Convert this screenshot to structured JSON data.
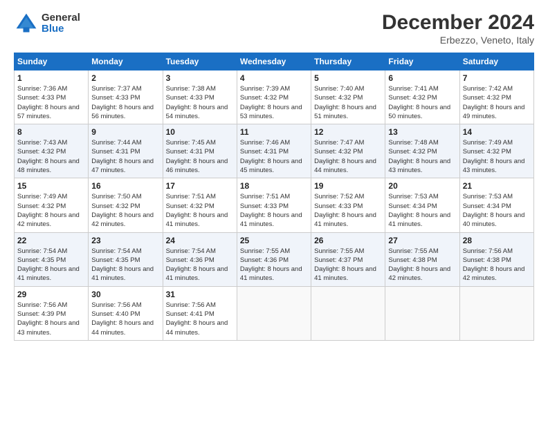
{
  "header": {
    "logo_general": "General",
    "logo_blue": "Blue",
    "title": "December 2024",
    "location": "Erbezzo, Veneto, Italy"
  },
  "weekdays": [
    "Sunday",
    "Monday",
    "Tuesday",
    "Wednesday",
    "Thursday",
    "Friday",
    "Saturday"
  ],
  "weeks": [
    [
      {
        "day": "1",
        "sunrise": "Sunrise: 7:36 AM",
        "sunset": "Sunset: 4:33 PM",
        "daylight": "Daylight: 8 hours and 57 minutes."
      },
      {
        "day": "2",
        "sunrise": "Sunrise: 7:37 AM",
        "sunset": "Sunset: 4:33 PM",
        "daylight": "Daylight: 8 hours and 56 minutes."
      },
      {
        "day": "3",
        "sunrise": "Sunrise: 7:38 AM",
        "sunset": "Sunset: 4:33 PM",
        "daylight": "Daylight: 8 hours and 54 minutes."
      },
      {
        "day": "4",
        "sunrise": "Sunrise: 7:39 AM",
        "sunset": "Sunset: 4:32 PM",
        "daylight": "Daylight: 8 hours and 53 minutes."
      },
      {
        "day": "5",
        "sunrise": "Sunrise: 7:40 AM",
        "sunset": "Sunset: 4:32 PM",
        "daylight": "Daylight: 8 hours and 51 minutes."
      },
      {
        "day": "6",
        "sunrise": "Sunrise: 7:41 AM",
        "sunset": "Sunset: 4:32 PM",
        "daylight": "Daylight: 8 hours and 50 minutes."
      },
      {
        "day": "7",
        "sunrise": "Sunrise: 7:42 AM",
        "sunset": "Sunset: 4:32 PM",
        "daylight": "Daylight: 8 hours and 49 minutes."
      }
    ],
    [
      {
        "day": "8",
        "sunrise": "Sunrise: 7:43 AM",
        "sunset": "Sunset: 4:32 PM",
        "daylight": "Daylight: 8 hours and 48 minutes."
      },
      {
        "day": "9",
        "sunrise": "Sunrise: 7:44 AM",
        "sunset": "Sunset: 4:31 PM",
        "daylight": "Daylight: 8 hours and 47 minutes."
      },
      {
        "day": "10",
        "sunrise": "Sunrise: 7:45 AM",
        "sunset": "Sunset: 4:31 PM",
        "daylight": "Daylight: 8 hours and 46 minutes."
      },
      {
        "day": "11",
        "sunrise": "Sunrise: 7:46 AM",
        "sunset": "Sunset: 4:31 PM",
        "daylight": "Daylight: 8 hours and 45 minutes."
      },
      {
        "day": "12",
        "sunrise": "Sunrise: 7:47 AM",
        "sunset": "Sunset: 4:32 PM",
        "daylight": "Daylight: 8 hours and 44 minutes."
      },
      {
        "day": "13",
        "sunrise": "Sunrise: 7:48 AM",
        "sunset": "Sunset: 4:32 PM",
        "daylight": "Daylight: 8 hours and 43 minutes."
      },
      {
        "day": "14",
        "sunrise": "Sunrise: 7:49 AM",
        "sunset": "Sunset: 4:32 PM",
        "daylight": "Daylight: 8 hours and 43 minutes."
      }
    ],
    [
      {
        "day": "15",
        "sunrise": "Sunrise: 7:49 AM",
        "sunset": "Sunset: 4:32 PM",
        "daylight": "Daylight: 8 hours and 42 minutes."
      },
      {
        "day": "16",
        "sunrise": "Sunrise: 7:50 AM",
        "sunset": "Sunset: 4:32 PM",
        "daylight": "Daylight: 8 hours and 42 minutes."
      },
      {
        "day": "17",
        "sunrise": "Sunrise: 7:51 AM",
        "sunset": "Sunset: 4:32 PM",
        "daylight": "Daylight: 8 hours and 41 minutes."
      },
      {
        "day": "18",
        "sunrise": "Sunrise: 7:51 AM",
        "sunset": "Sunset: 4:33 PM",
        "daylight": "Daylight: 8 hours and 41 minutes."
      },
      {
        "day": "19",
        "sunrise": "Sunrise: 7:52 AM",
        "sunset": "Sunset: 4:33 PM",
        "daylight": "Daylight: 8 hours and 41 minutes."
      },
      {
        "day": "20",
        "sunrise": "Sunrise: 7:53 AM",
        "sunset": "Sunset: 4:34 PM",
        "daylight": "Daylight: 8 hours and 41 minutes."
      },
      {
        "day": "21",
        "sunrise": "Sunrise: 7:53 AM",
        "sunset": "Sunset: 4:34 PM",
        "daylight": "Daylight: 8 hours and 40 minutes."
      }
    ],
    [
      {
        "day": "22",
        "sunrise": "Sunrise: 7:54 AM",
        "sunset": "Sunset: 4:35 PM",
        "daylight": "Daylight: 8 hours and 41 minutes."
      },
      {
        "day": "23",
        "sunrise": "Sunrise: 7:54 AM",
        "sunset": "Sunset: 4:35 PM",
        "daylight": "Daylight: 8 hours and 41 minutes."
      },
      {
        "day": "24",
        "sunrise": "Sunrise: 7:54 AM",
        "sunset": "Sunset: 4:36 PM",
        "daylight": "Daylight: 8 hours and 41 minutes."
      },
      {
        "day": "25",
        "sunrise": "Sunrise: 7:55 AM",
        "sunset": "Sunset: 4:36 PM",
        "daylight": "Daylight: 8 hours and 41 minutes."
      },
      {
        "day": "26",
        "sunrise": "Sunrise: 7:55 AM",
        "sunset": "Sunset: 4:37 PM",
        "daylight": "Daylight: 8 hours and 41 minutes."
      },
      {
        "day": "27",
        "sunrise": "Sunrise: 7:55 AM",
        "sunset": "Sunset: 4:38 PM",
        "daylight": "Daylight: 8 hours and 42 minutes."
      },
      {
        "day": "28",
        "sunrise": "Sunrise: 7:56 AM",
        "sunset": "Sunset: 4:38 PM",
        "daylight": "Daylight: 8 hours and 42 minutes."
      }
    ],
    [
      {
        "day": "29",
        "sunrise": "Sunrise: 7:56 AM",
        "sunset": "Sunset: 4:39 PM",
        "daylight": "Daylight: 8 hours and 43 minutes."
      },
      {
        "day": "30",
        "sunrise": "Sunrise: 7:56 AM",
        "sunset": "Sunset: 4:40 PM",
        "daylight": "Daylight: 8 hours and 44 minutes."
      },
      {
        "day": "31",
        "sunrise": "Sunrise: 7:56 AM",
        "sunset": "Sunset: 4:41 PM",
        "daylight": "Daylight: 8 hours and 44 minutes."
      },
      null,
      null,
      null,
      null
    ]
  ]
}
